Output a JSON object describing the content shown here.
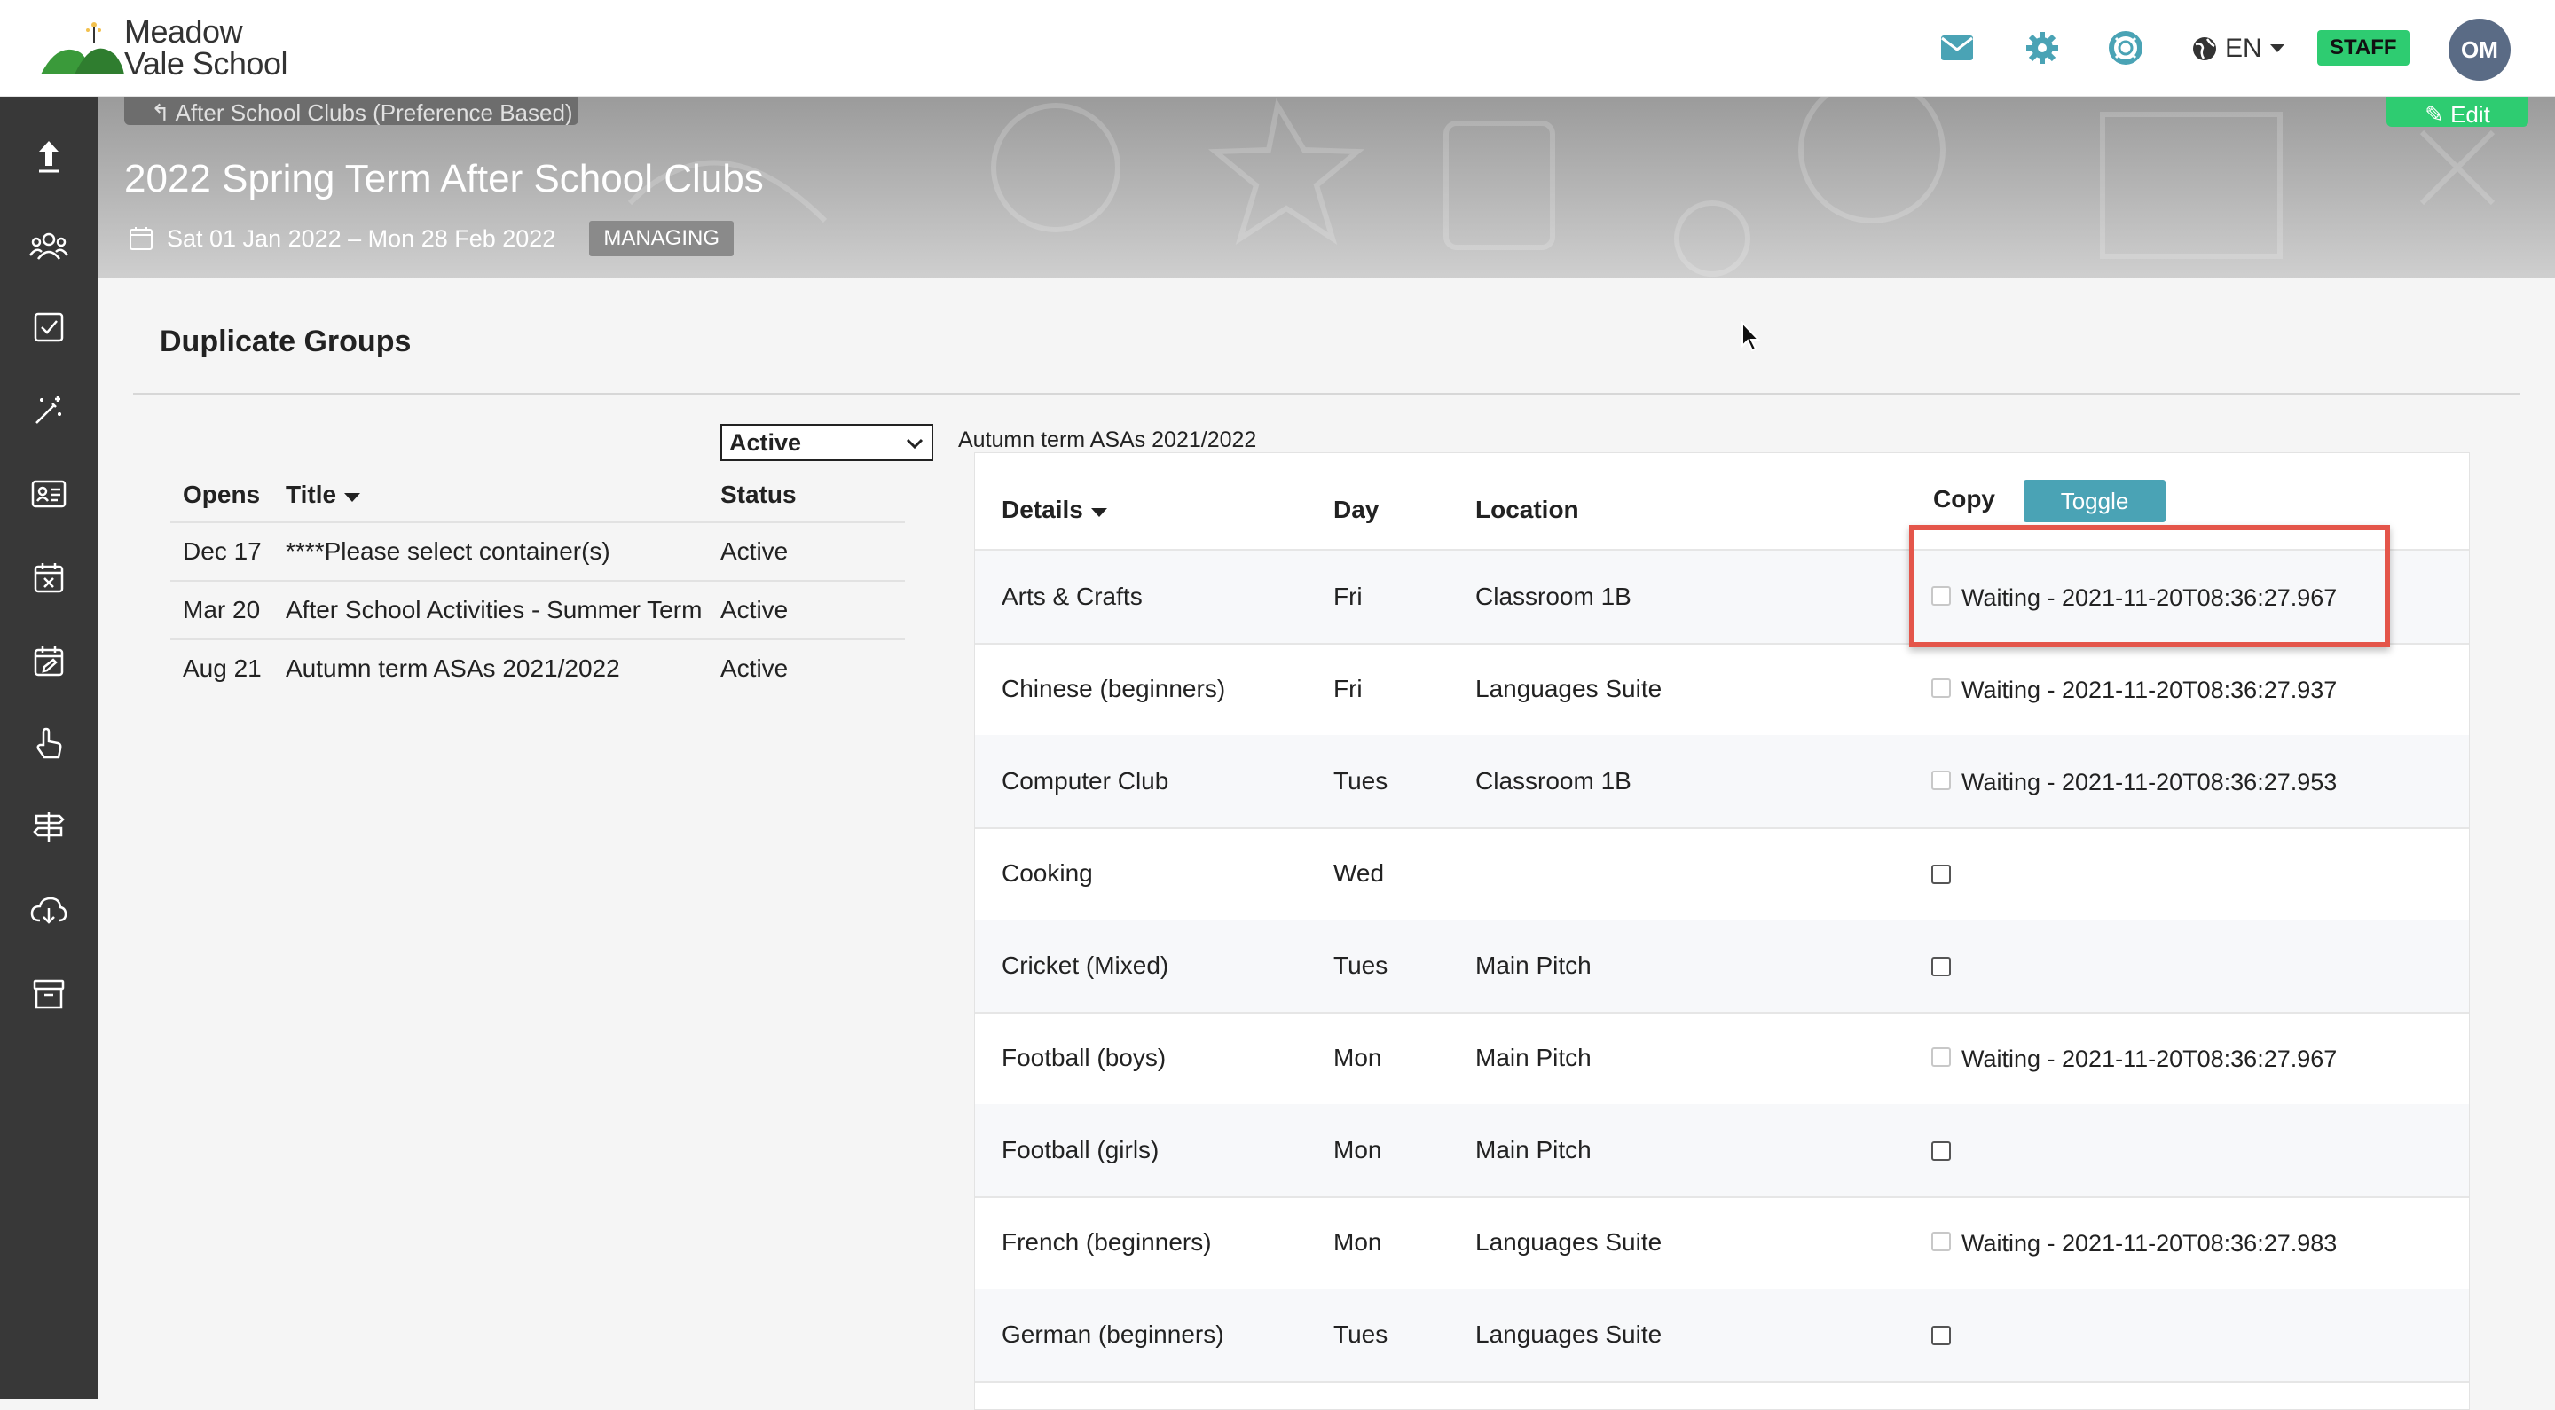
{
  "header": {
    "logo_line1": "Meadow",
    "logo_line2": "Vale School",
    "language": "EN",
    "staff_badge": "STAFF",
    "avatar_initials": "OM",
    "icons": [
      "envelope-icon",
      "gear-icon",
      "lifebuoy-icon",
      "globe-icon"
    ],
    "colors": {
      "icon": "#4aa3b5",
      "staff": "#2ecc71",
      "avatar": "#5a6b85"
    }
  },
  "sidebar": {
    "items": [
      "upload-icon",
      "people-icon",
      "checkbox-icon",
      "magic-wand-icon",
      "id-card-icon",
      "calendar-x-icon",
      "calendar-edit-icon",
      "hand-pointer-icon",
      "signpost-icon",
      "cloud-download-icon",
      "archive-icon"
    ]
  },
  "banner": {
    "breadcrumb": "After School Clubs (Preference Based)",
    "edit_label": "Edit",
    "title": "2022 Spring Term After School Clubs",
    "dates": "Sat 01 Jan 2022 – Mon 28 Feb 2022",
    "managing_badge": "MANAGING"
  },
  "main": {
    "section_title": "Duplicate Groups"
  },
  "groups_table": {
    "status_filter": "Active",
    "headers": {
      "opens": "Opens",
      "title": "Title",
      "status": "Status"
    },
    "rows": [
      {
        "opens": "Dec 17",
        "title": "****Please select container(s)",
        "status": "Active"
      },
      {
        "opens": "Mar 20",
        "title": "After School Activities - Summer Term",
        "status": "Active"
      },
      {
        "opens": "Aug 21",
        "title": "Autumn term ASAs 2021/2022",
        "status": "Active"
      }
    ]
  },
  "clubs_panel": {
    "label": "Autumn term ASAs 2021/2022",
    "headers": {
      "details": "Details",
      "day": "Day",
      "location": "Location",
      "copy": "Copy"
    },
    "toggle_label": "Toggle",
    "rows": [
      {
        "details": "Arts & Crafts",
        "day": "Fri",
        "location": "Classroom 1B",
        "copy_status": "Waiting - 2021-11-20T08:36:27.967"
      },
      {
        "details": "Chinese (beginners)",
        "day": "Fri",
        "location": "Languages Suite",
        "copy_status": "Waiting - 2021-11-20T08:36:27.937"
      },
      {
        "details": "Computer Club",
        "day": "Tues",
        "location": "Classroom 1B",
        "copy_status": "Waiting - 2021-11-20T08:36:27.953"
      },
      {
        "details": "Cooking",
        "day": "Wed",
        "location": "",
        "copy_status": ""
      },
      {
        "details": "Cricket (Mixed)",
        "day": "Tues",
        "location": "Main Pitch",
        "copy_status": ""
      },
      {
        "details": "Football (boys)",
        "day": "Mon",
        "location": "Main Pitch",
        "copy_status": "Waiting - 2021-11-20T08:36:27.967"
      },
      {
        "details": "Football (girls)",
        "day": "Mon",
        "location": "Main Pitch",
        "copy_status": ""
      },
      {
        "details": "French (beginners)",
        "day": "Mon",
        "location": "Languages Suite",
        "copy_status": "Waiting - 2021-11-20T08:36:27.983"
      },
      {
        "details": "German (beginners)",
        "day": "Tues",
        "location": "Languages Suite",
        "copy_status": ""
      }
    ]
  }
}
